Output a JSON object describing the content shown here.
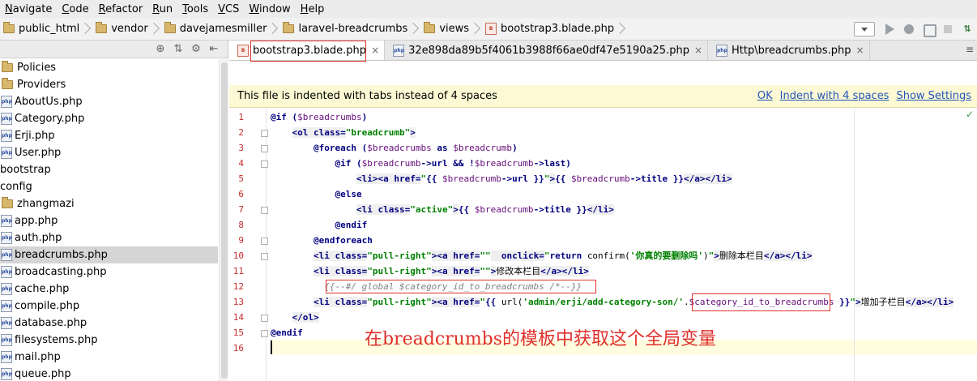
{
  "menu": [
    "Navigate",
    "Code",
    "Refactor",
    "Run",
    "Tools",
    "VCS",
    "Window",
    "Help"
  ],
  "breadcrumb": [
    "public_html",
    "vendor",
    "davejamesmiller",
    "laravel-breadcrumbs",
    "views",
    "bootstrap3.blade.php"
  ],
  "toolbar_icons": [
    "run-config-dropdown",
    "run-icon",
    "debug-icon",
    "coverage-icon",
    "stop-icon",
    "vcs-update-icon"
  ],
  "sidebar": {
    "items": [
      {
        "label": "Policies",
        "icon": "folder-icon"
      },
      {
        "label": "Providers",
        "icon": "folder-icon"
      },
      {
        "label": "AboutUs.php",
        "icon": "php-file-icon"
      },
      {
        "label": "Category.php",
        "icon": "php-file-icon"
      },
      {
        "label": "Erji.php",
        "icon": "php-file-icon"
      },
      {
        "label": "User.php",
        "icon": "php-file-icon"
      },
      {
        "label": "bootstrap",
        "icon": "folder-icon"
      },
      {
        "label": "config",
        "icon": "folder-icon"
      },
      {
        "label": "zhangmazi",
        "icon": "folder-icon"
      },
      {
        "label": "app.php",
        "icon": "php-file-icon"
      },
      {
        "label": "auth.php",
        "icon": "php-file-icon"
      },
      {
        "label": "breadcrumbs.php",
        "icon": "php-file-icon",
        "selected": true
      },
      {
        "label": "broadcasting.php",
        "icon": "php-file-icon"
      },
      {
        "label": "cache.php",
        "icon": "php-file-icon"
      },
      {
        "label": "compile.php",
        "icon": "php-file-icon"
      },
      {
        "label": "database.php",
        "icon": "php-file-icon"
      },
      {
        "label": "filesystems.php",
        "icon": "php-file-icon"
      },
      {
        "label": "mail.php",
        "icon": "php-file-icon"
      },
      {
        "label": "queue.php",
        "icon": "php-file-icon"
      }
    ]
  },
  "tabs": [
    {
      "label": "bootstrap3.blade.php",
      "active": true
    },
    {
      "label": "32e898da89b5f4061b3988f66ae0df47e5190a25.php",
      "active": false
    },
    {
      "label": "Http\\breadcrumbs.php",
      "active": false
    }
  ],
  "notice": {
    "text": "This file is indented with tabs instead of 4 spaces",
    "actions": [
      "OK",
      "Indent with 4 spaces",
      "Show Settings"
    ]
  },
  "editor": {
    "line_numbers": [
      "1",
      "2",
      "3",
      "4",
      "5",
      "6",
      "7",
      "8",
      "9",
      "10",
      "11",
      "12",
      "13",
      "14",
      "15",
      "16"
    ],
    "lines": [
      [
        {
          "t": "@if (",
          "c": "kw"
        },
        {
          "t": "$breadcrumbs",
          "c": "var"
        },
        {
          "t": ")",
          "c": "kw"
        }
      ],
      [
        {
          "t": "    "
        },
        {
          "t": "<ol ",
          "c": "tag"
        },
        {
          "t": "class=",
          "c": "tag"
        },
        {
          "t": "\"breadcrumb\"",
          "c": "str"
        },
        {
          "t": ">",
          "c": "tag"
        }
      ],
      [
        {
          "t": "        "
        },
        {
          "t": "@foreach (",
          "c": "kw"
        },
        {
          "t": "$breadcrumbs",
          "c": "var"
        },
        {
          "t": " as ",
          "c": "kw"
        },
        {
          "t": "$breadcrumb",
          "c": "var"
        },
        {
          "t": ")",
          "c": "kw"
        }
      ],
      [
        {
          "t": "            "
        },
        {
          "t": "@if (",
          "c": "kw"
        },
        {
          "t": "$breadcrumb",
          "c": "var"
        },
        {
          "t": "->url && !",
          "c": "kw"
        },
        {
          "t": "$breadcrumb",
          "c": "var"
        },
        {
          "t": "->last)",
          "c": "kw"
        }
      ],
      [
        {
          "t": "                "
        },
        {
          "t": "<li>",
          "c": "tag"
        },
        {
          "t": "<a ",
          "c": "tag"
        },
        {
          "t": "href=",
          "c": "tag"
        },
        {
          "t": "\"",
          "c": "str"
        },
        {
          "t": "{{ ",
          "c": "kw"
        },
        {
          "t": "$breadcrumb",
          "c": "var"
        },
        {
          "t": "->url }}",
          "c": "kw"
        },
        {
          "t": "\"",
          "c": "str"
        },
        {
          "t": ">",
          "c": "tag"
        },
        {
          "t": "{{ ",
          "c": "kw"
        },
        {
          "t": "$breadcrumb",
          "c": "var"
        },
        {
          "t": "->title }}",
          "c": "kw"
        },
        {
          "t": "</a>",
          "c": "tag"
        },
        {
          "t": "</li>",
          "c": "tag"
        }
      ],
      [
        {
          "t": "            "
        },
        {
          "t": "@else",
          "c": "kw"
        }
      ],
      [
        {
          "t": "                "
        },
        {
          "t": "<li ",
          "c": "tag"
        },
        {
          "t": "class=",
          "c": "tag"
        },
        {
          "t": "\"active\"",
          "c": "str"
        },
        {
          "t": ">",
          "c": "tag"
        },
        {
          "t": "{{ ",
          "c": "kw"
        },
        {
          "t": "$breadcrumb",
          "c": "var"
        },
        {
          "t": "->title }}",
          "c": "kw"
        },
        {
          "t": "</li>",
          "c": "tag"
        }
      ],
      [
        {
          "t": "            "
        },
        {
          "t": "@endif",
          "c": "kw"
        }
      ],
      [
        {
          "t": "        "
        },
        {
          "t": "@endforeach",
          "c": "kw"
        }
      ],
      [
        {
          "t": "        "
        },
        {
          "t": "<li ",
          "c": "tag"
        },
        {
          "t": "class=",
          "c": "tag"
        },
        {
          "t": "\"pull-right\"",
          "c": "str"
        },
        {
          "t": ">",
          "c": "tag"
        },
        {
          "t": "<a ",
          "c": "tag"
        },
        {
          "t": "href=",
          "c": "tag"
        },
        {
          "t": "\"\"",
          "c": "str"
        },
        {
          "t": "  onclick=",
          "c": "tag"
        },
        {
          "t": "\"",
          "c": "str"
        },
        {
          "t": "return ",
          "c": "kw"
        },
        {
          "t": "confirm(",
          "c": "fn"
        },
        {
          "t": "'你真的要删除吗'",
          "c": "str"
        },
        {
          "t": ")",
          "c": "fn"
        },
        {
          "t": "\"",
          "c": "str"
        },
        {
          "t": ">",
          "c": "tag"
        },
        {
          "t": "删除本栏目"
        },
        {
          "t": "</a>",
          "c": "tag"
        },
        {
          "t": "</li>",
          "c": "tag"
        }
      ],
      [
        {
          "t": "        "
        },
        {
          "t": "<li ",
          "c": "tag"
        },
        {
          "t": "class=",
          "c": "tag"
        },
        {
          "t": "\"pull-right\"",
          "c": "str"
        },
        {
          "t": ">",
          "c": "tag"
        },
        {
          "t": "<a ",
          "c": "tag"
        },
        {
          "t": "href=",
          "c": "tag"
        },
        {
          "t": "\"\"",
          "c": "str"
        },
        {
          "t": ">",
          "c": "tag"
        },
        {
          "t": "修改本栏目"
        },
        {
          "t": "</a>",
          "c": "tag"
        },
        {
          "t": "</li>",
          "c": "tag"
        }
      ],
      [
        {
          "t": "          "
        },
        {
          "t": "{{--#/ global $category_id_to_breadcrumbs /*--}}",
          "c": "cmt"
        }
      ],
      [
        {
          "t": "        "
        },
        {
          "t": "<li ",
          "c": "tag"
        },
        {
          "t": "class=",
          "c": "tag"
        },
        {
          "t": "\"pull-right\"",
          "c": "str"
        },
        {
          "t": ">",
          "c": "tag"
        },
        {
          "t": "<a ",
          "c": "tag"
        },
        {
          "t": "href=",
          "c": "tag"
        },
        {
          "t": "\"",
          "c": "str"
        },
        {
          "t": "{{ ",
          "c": "kw"
        },
        {
          "t": "url(",
          "c": "fn"
        },
        {
          "t": "'admin/erji/add-category-son/'",
          "c": "str"
        },
        {
          "t": ".",
          "c": "fn"
        },
        {
          "t": "$category_id_to_breadcrumbs",
          "c": "var"
        },
        {
          "t": " }}",
          "c": "kw"
        },
        {
          "t": "\"",
          "c": "str"
        },
        {
          "t": ">",
          "c": "tag"
        },
        {
          "t": "增加子栏目"
        },
        {
          "t": "</a>",
          "c": "tag"
        },
        {
          "t": "</li>",
          "c": "tag"
        }
      ],
      [
        {
          "t": "    "
        },
        {
          "t": "</ol>",
          "c": "tag"
        }
      ],
      [
        {
          "t": "@endif",
          "c": "kw"
        }
      ],
      [
        {
          "t": ""
        }
      ]
    ],
    "annotation": "在breadcrumbs的模板中获取这个全局变量"
  },
  "colors": {
    "annotation": "#e0302c",
    "line_number": "#c62c2c",
    "link": "#2255bb",
    "notice_bg": "#fdf9d4",
    "selected_row": "#d5d5d5"
  }
}
